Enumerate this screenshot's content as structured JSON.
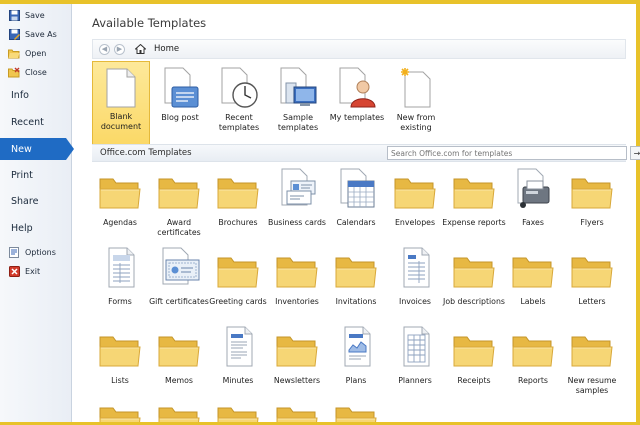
{
  "sidebar": {
    "commands": [
      {
        "label": "Save",
        "icon": "save-icon"
      },
      {
        "label": "Save As",
        "icon": "save-as-icon"
      },
      {
        "label": "Open",
        "icon": "open-folder-icon"
      },
      {
        "label": "Close",
        "icon": "close-folder-icon"
      }
    ],
    "tabs": [
      {
        "label": "Info"
      },
      {
        "label": "Recent"
      },
      {
        "label": "New",
        "active": true
      },
      {
        "label": "Print"
      },
      {
        "label": "Share"
      },
      {
        "label": "Help"
      }
    ],
    "footer": [
      {
        "label": "Options",
        "icon": "options-icon"
      },
      {
        "label": "Exit",
        "icon": "exit-icon"
      }
    ]
  },
  "main": {
    "title": "Available Templates",
    "breadcrumb": {
      "home_label": "Home"
    },
    "available_templates": [
      {
        "label": "Blank document",
        "icon": "blank-document-icon",
        "selected": true
      },
      {
        "label": "Blog post",
        "icon": "blog-post-icon"
      },
      {
        "label": "Recent templates",
        "icon": "recent-templates-icon"
      },
      {
        "label": "Sample templates",
        "icon": "sample-templates-icon"
      },
      {
        "label": "My templates",
        "icon": "my-templates-icon"
      },
      {
        "label": "New from existing",
        "icon": "new-from-existing-icon"
      }
    ],
    "office_section": {
      "title": "Office.com Templates",
      "search_placeholder": "Search Office.com for templates",
      "search_button": "→"
    },
    "office_templates": [
      {
        "label": "Agendas",
        "icon": "folder-icon"
      },
      {
        "label": "Award certificates",
        "icon": "folder-icon"
      },
      {
        "label": "Brochures",
        "icon": "folder-icon"
      },
      {
        "label": "Business cards",
        "icon": "business-cards-icon"
      },
      {
        "label": "Calendars",
        "icon": "calendar-icon"
      },
      {
        "label": "Envelopes",
        "icon": "folder-icon"
      },
      {
        "label": "Expense reports",
        "icon": "folder-icon"
      },
      {
        "label": "Faxes",
        "icon": "fax-icon"
      },
      {
        "label": "Flyers",
        "icon": "folder-icon"
      },
      {
        "label": "Forms",
        "icon": "form-doc-icon"
      },
      {
        "label": "Gift certificates",
        "icon": "gift-certificate-icon"
      },
      {
        "label": "Greeting cards",
        "icon": "folder-icon"
      },
      {
        "label": "Inventories",
        "icon": "folder-icon"
      },
      {
        "label": "Invitations",
        "icon": "folder-icon"
      },
      {
        "label": "Invoices",
        "icon": "invoice-doc-icon"
      },
      {
        "label": "Job descriptions",
        "icon": "folder-icon"
      },
      {
        "label": "Labels",
        "icon": "folder-icon"
      },
      {
        "label": "Letters",
        "icon": "folder-icon"
      },
      {
        "label": "Lists",
        "icon": "folder-icon"
      },
      {
        "label": "Memos",
        "icon": "folder-icon"
      },
      {
        "label": "Minutes",
        "icon": "minutes-doc-icon"
      },
      {
        "label": "Newsletters",
        "icon": "folder-icon"
      },
      {
        "label": "Plans",
        "icon": "plans-doc-icon"
      },
      {
        "label": "Planners",
        "icon": "planners-doc-icon"
      },
      {
        "label": "Receipts",
        "icon": "folder-icon"
      },
      {
        "label": "Reports",
        "icon": "folder-icon"
      },
      {
        "label": "New resume samples",
        "icon": "folder-icon"
      }
    ]
  },
  "colors": {
    "frame": "#e8c22a",
    "active_tab": "#1f6bc4",
    "selected_tile": "#fbd866",
    "folder": "#f3cf63"
  }
}
